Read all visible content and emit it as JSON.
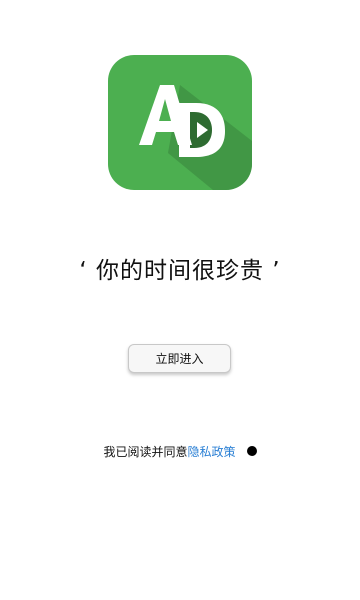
{
  "app": {
    "logo_text": "AD",
    "brand_color": "#4caf50",
    "logo_icon": "ad-logo-play-icon"
  },
  "slogan": "‘ 你的时间很珍贵 ’",
  "enter_button": {
    "label": "立即进入"
  },
  "agreement": {
    "prefix": "我已阅读并同意",
    "link_label": "隐私政策",
    "link_color": "#2a7fd4",
    "checked": true
  }
}
